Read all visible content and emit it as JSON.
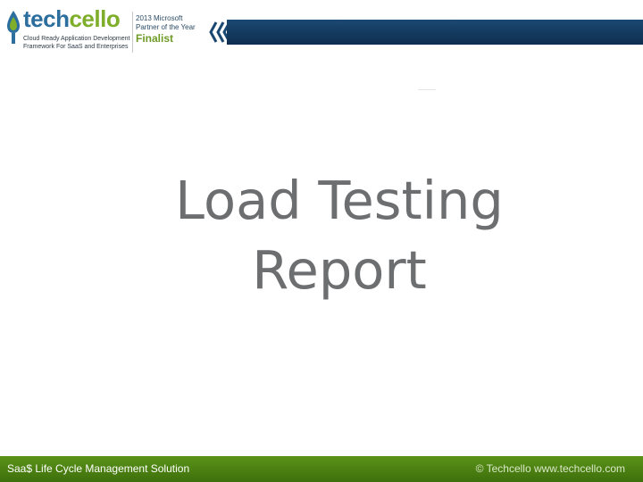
{
  "logo": {
    "brand_part1": "tech",
    "brand_part2": "cello",
    "tagline_line1": "Cloud Ready Application Development",
    "tagline_line2": "Framework For SaaS and Enterprises",
    "icon": "drop-icon",
    "colors": {
      "brand_blue": "#2c6f9e",
      "brand_green": "#7fae2b"
    }
  },
  "award": {
    "line1": "2013 Microsoft",
    "line2": "Partner of the Year",
    "line3": "Finalist"
  },
  "header": {
    "bar_color": "#0e2e4f",
    "icon": "double-chevron-left-icon"
  },
  "title": {
    "line1": "Load Testing",
    "line2": "Report",
    "color": "#6d6e70"
  },
  "footer": {
    "tagline": "Saa$ Life Cycle Management Solution",
    "copyright": "© Techcello www.techcello.com",
    "color": "#4f8414"
  }
}
